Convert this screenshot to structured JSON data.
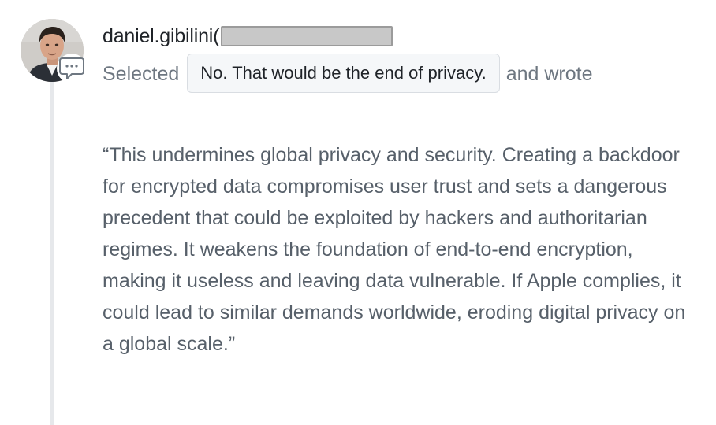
{
  "comment": {
    "username": "daniel.gibilini(",
    "action_word": "Selected",
    "selected_option": "No. That would be the end of privacy.",
    "connector": "and wrote",
    "body": "“This undermines global privacy and security. Creating a backdoor for encrypted data compromises user trust and sets a dangerous precedent that could be exploited by hackers and authoritarian regimes. It weakens the foundation of end-to-end encryption, making it useless and leaving data vulnerable. If Apple complies, it could lead to similar demands worldwide, eroding digital privacy on a global scale.”"
  },
  "icons": {
    "comment_badge": "speech-bubble-icon"
  },
  "colors": {
    "username": "#1f2328",
    "secondary_text": "#6e7781",
    "body_text": "#57606a",
    "chip_background": "#f5f7f9",
    "chip_border": "#d9dde2",
    "timeline": "#e6e8eb",
    "redaction": "#c8c8c8"
  }
}
